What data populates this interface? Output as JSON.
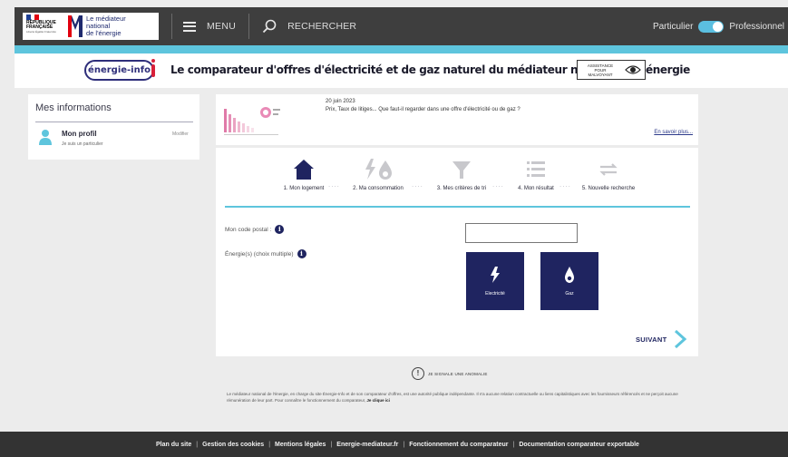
{
  "header": {
    "republique_label": "RÉPUBLIQUE\nFRANÇAISE",
    "republique_motto": "Liberté Égalité Fraternité",
    "mediateur_label": "Le médiateur\nnational\nde l'énergie",
    "menu_label": "MENU",
    "search_label": "RECHERCHER",
    "switch_left": "Particulier",
    "switch_right": "Professionnel",
    "accent_color": "#5ec5dd"
  },
  "banner": {
    "logo_text": "énergie-info",
    "title": "Le comparateur d'offres d'électricité et de gaz naturel du médiateur national de l'énergie",
    "assistance_label": "ASSISTANCE\nPOUR\nMALVOYANT"
  },
  "sidebar": {
    "title": "Mes informations",
    "profile_name": "Mon profil",
    "profile_sub": "Je suis un particulier",
    "modify_label": "Modifier"
  },
  "news": {
    "date": "20 juin 2023",
    "text": "Prix, Taux de litiges... Que faut-il regarder dans une offre d'électricité ou de gaz ?",
    "more_label": "En savoir plus..."
  },
  "steps": [
    {
      "label": "1. Mon logement",
      "icon": "house-icon",
      "active": true
    },
    {
      "label": "2. Ma consommation",
      "icon": "energy-icon",
      "active": false
    },
    {
      "label": "3. Mes critères de tri",
      "icon": "filter-icon",
      "active": false
    },
    {
      "label": "4. Mon résultat",
      "icon": "list-icon",
      "active": false
    },
    {
      "label": "5. Nouvelle recherche",
      "icon": "refresh-icon",
      "active": false
    }
  ],
  "form": {
    "postal_label": "Mon code postal :",
    "postal_value": "",
    "energy_label": "Énergie(s) (choix multiple)",
    "energies": [
      {
        "label": "Electricité",
        "icon": "lightning-icon"
      },
      {
        "label": "Gaz",
        "icon": "flame-icon"
      }
    ],
    "next_label": "SUIVANT",
    "brand_color": "#1f2460"
  },
  "report": {
    "label": "JE SIGNALE UNE ANOMALIE"
  },
  "disclaimer": {
    "text": "Le médiateur national de l'énergie, en charge du site Énergie-Info et de son comparateur d'offres, est une autorité publique indépendante. Il n'a aucune relation contractuelle ou liens capitalistiques avec les fournisseurs référencés et ne perçoit aucune rémunération de leur part. Pour connaître le fonctionnement du comparateur,",
    "link": "Je clique ici"
  },
  "footer": {
    "links": [
      "Plan du site",
      "Gestion des cookies",
      "Mentions légales",
      "Energie-mediateur.fr",
      "Fonctionnement du comparateur",
      "Documentation comparateur exportable"
    ]
  }
}
